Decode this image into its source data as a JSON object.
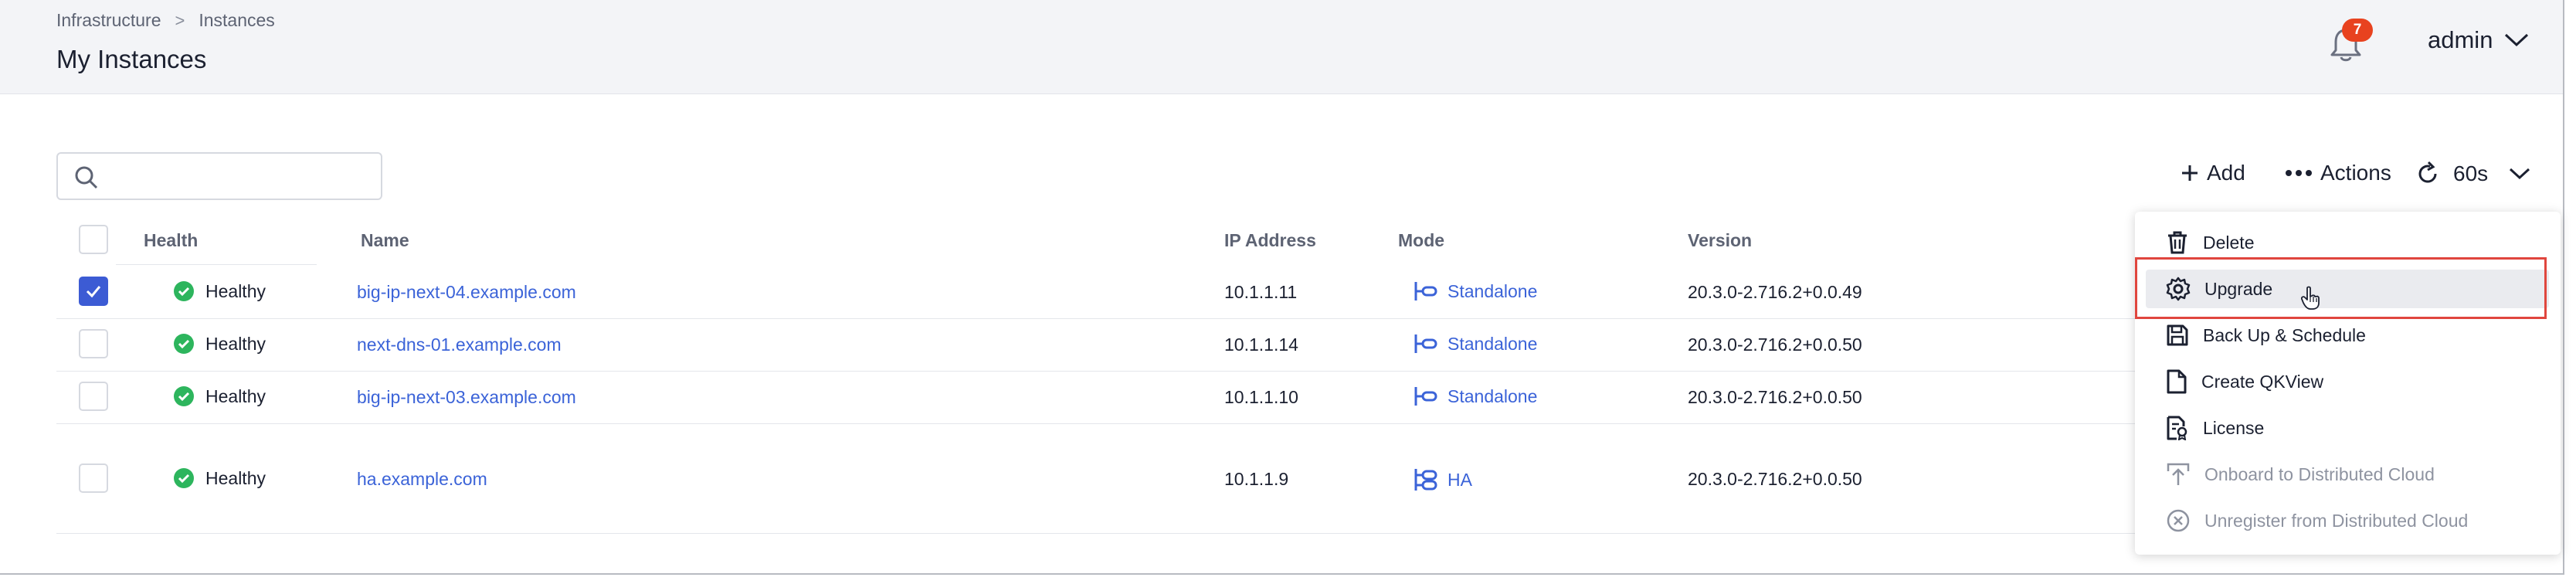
{
  "breadcrumb": {
    "root": "Infrastructure",
    "separator": ">",
    "current": "Instances"
  },
  "page": {
    "title": "My Instances"
  },
  "header": {
    "notification_count": "7",
    "user": "admin"
  },
  "search": {
    "placeholder": "",
    "value": ""
  },
  "toolbar": {
    "add_label": "Add",
    "actions_label": "Actions",
    "refresh_interval": "60s"
  },
  "table": {
    "columns": {
      "health": "Health",
      "name": "Name",
      "ip": "IP Address",
      "mode": "Mode",
      "version": "Version"
    },
    "rows": [
      {
        "checked": true,
        "health": "Healthy",
        "name": "big-ip-next-04.example.com",
        "ip": "10.1.1.11",
        "mode": "Standalone",
        "version": "20.3.0-2.716.2+0.0.49"
      },
      {
        "checked": false,
        "health": "Healthy",
        "name": "next-dns-01.example.com",
        "ip": "10.1.1.14",
        "mode": "Standalone",
        "version": "20.3.0-2.716.2+0.0.50"
      },
      {
        "checked": false,
        "health": "Healthy",
        "name": "big-ip-next-03.example.com",
        "ip": "10.1.1.10",
        "mode": "Standalone",
        "version": "20.3.0-2.716.2+0.0.50"
      },
      {
        "checked": false,
        "health": "Healthy",
        "name": "ha.example.com",
        "ip": "10.1.1.9",
        "mode": "HA",
        "version": "20.3.0-2.716.2+0.0.50"
      }
    ]
  },
  "actions_menu": {
    "items": [
      {
        "label": "Delete",
        "icon": "trash-icon",
        "disabled": false
      },
      {
        "label": "Upgrade",
        "icon": "gear-icon",
        "disabled": false,
        "hovered": true
      },
      {
        "label": "Back Up & Schedule",
        "icon": "save-icon",
        "disabled": false
      },
      {
        "label": "Create QKView",
        "icon": "file-icon",
        "disabled": false
      },
      {
        "label": "License",
        "icon": "license-icon",
        "disabled": false
      },
      {
        "label": "Onboard to Distributed Cloud",
        "icon": "upload-icon",
        "disabled": true
      },
      {
        "label": "Unregister from Distributed Cloud",
        "icon": "circle-x-icon",
        "disabled": true
      }
    ]
  },
  "colors": {
    "link": "#3b63d8",
    "healthy": "#2db55d",
    "checkbox_checked": "#3c5bd4",
    "badge": "#e8421f",
    "highlight": "#e0463e"
  }
}
